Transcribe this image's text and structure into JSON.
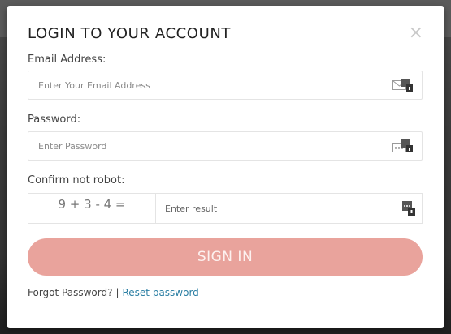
{
  "modal": {
    "title": "LOGIN TO YOUR ACCOUNT",
    "close_glyph": "×"
  },
  "email": {
    "label": "Email Address:",
    "placeholder": "Enter Your Email Address",
    "value": "",
    "icon": "email-lock-icon"
  },
  "password": {
    "label": "Password:",
    "placeholder": "Enter Password",
    "value": "",
    "icon": "password-lock-icon"
  },
  "captcha": {
    "label": "Confirm not robot:",
    "question": "9 + 3 - 4 =",
    "placeholder": "Enter result",
    "value": "",
    "icon": "lock-icon"
  },
  "signin": {
    "label": "SIGN IN"
  },
  "footer": {
    "forgot_text": "Forgot Password?",
    "separator": "|",
    "reset_link": "Reset password"
  },
  "colors": {
    "accent": "#e9a39c",
    "link": "#2a7ea3",
    "title": "#222222"
  }
}
